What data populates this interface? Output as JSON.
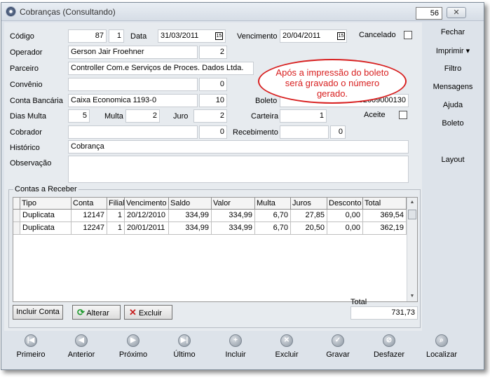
{
  "window": {
    "title": "Cobranças (Consultando)",
    "counter": "56",
    "close_label": "✕"
  },
  "form": {
    "codigo_label": "Código",
    "codigo": "87",
    "codigo_suffix": "1",
    "data_label": "Data",
    "data": "31/03/2011",
    "vencimento_label": "Vencimento",
    "vencimento": "20/04/2011",
    "cancelado_label": "Cancelado",
    "operador_label": "Operador",
    "operador": "Gerson Jair Froehner",
    "operador_code": "2",
    "parceiro_label": "Parceiro",
    "parceiro": "Controller Com.e Serviços de Proces. Dados Ltda.",
    "convenio_label": "Convênio",
    "convenio": "",
    "convenio_code": "0",
    "conta_label": "Conta Bancária",
    "conta": "Caixa Economica 1193-0",
    "conta_code": "10",
    "boleto_label": "Boleto",
    "boleto": "82009000130",
    "dias_multa_label": "Dias Multa",
    "dias_multa": "5",
    "multa_label": "Multa",
    "multa": "2",
    "juro_label": "Juro",
    "juro": "2",
    "carteira_label": "Carteira",
    "carteira": "1",
    "aceite_label": "Aceite",
    "cobrador_label": "Cobrador",
    "cobrador": "",
    "cobrador_code": "0",
    "recebimento_label": "Recebimento",
    "recebimento": "",
    "recebimento_code": "0",
    "historico_label": "Histórico",
    "historico": "Cobrança",
    "observacao_label": "Observação",
    "observacao": ""
  },
  "callout": "Após a impressão do boleto será gravado o número gerado.",
  "contas": {
    "legend": "Contas a Receber",
    "columns": [
      "Tipo",
      "Conta",
      "Filial",
      "Vencimento",
      "Saldo",
      "Valor",
      "Multa",
      "Juros",
      "Desconto",
      "Total"
    ],
    "rows": [
      [
        "Duplicata",
        "12147",
        "1",
        "20/12/2010",
        "334,99",
        "334,99",
        "6,70",
        "27,85",
        "0,00",
        "369,54"
      ],
      [
        "Duplicata",
        "12247",
        "1",
        "20/01/2011",
        "334,99",
        "334,99",
        "6,70",
        "20,50",
        "0,00",
        "362,19"
      ]
    ],
    "incluir_label": "Incluir Conta",
    "alterar_label": "Alterar",
    "excluir_label": "Excluir",
    "total_label": "Total",
    "total_value": "731,73"
  },
  "sidebar": {
    "items": [
      "Fechar",
      "Imprimir ▾",
      "Filtro",
      "Mensagens",
      "Ajuda",
      "Boleto",
      "Layout"
    ]
  },
  "nav": {
    "items": [
      "Primeiro",
      "Anterior",
      "Próximo",
      "Último",
      "Incluir",
      "Excluir",
      "Gravar",
      "Desfazer",
      "Localizar"
    ],
    "icons": [
      "first-record-icon",
      "prev-arrow-icon",
      "next-arrow-icon",
      "last-record-icon",
      "plus-icon",
      "x-icon",
      "check-icon",
      "undo-icon",
      "search-icon"
    ]
  }
}
